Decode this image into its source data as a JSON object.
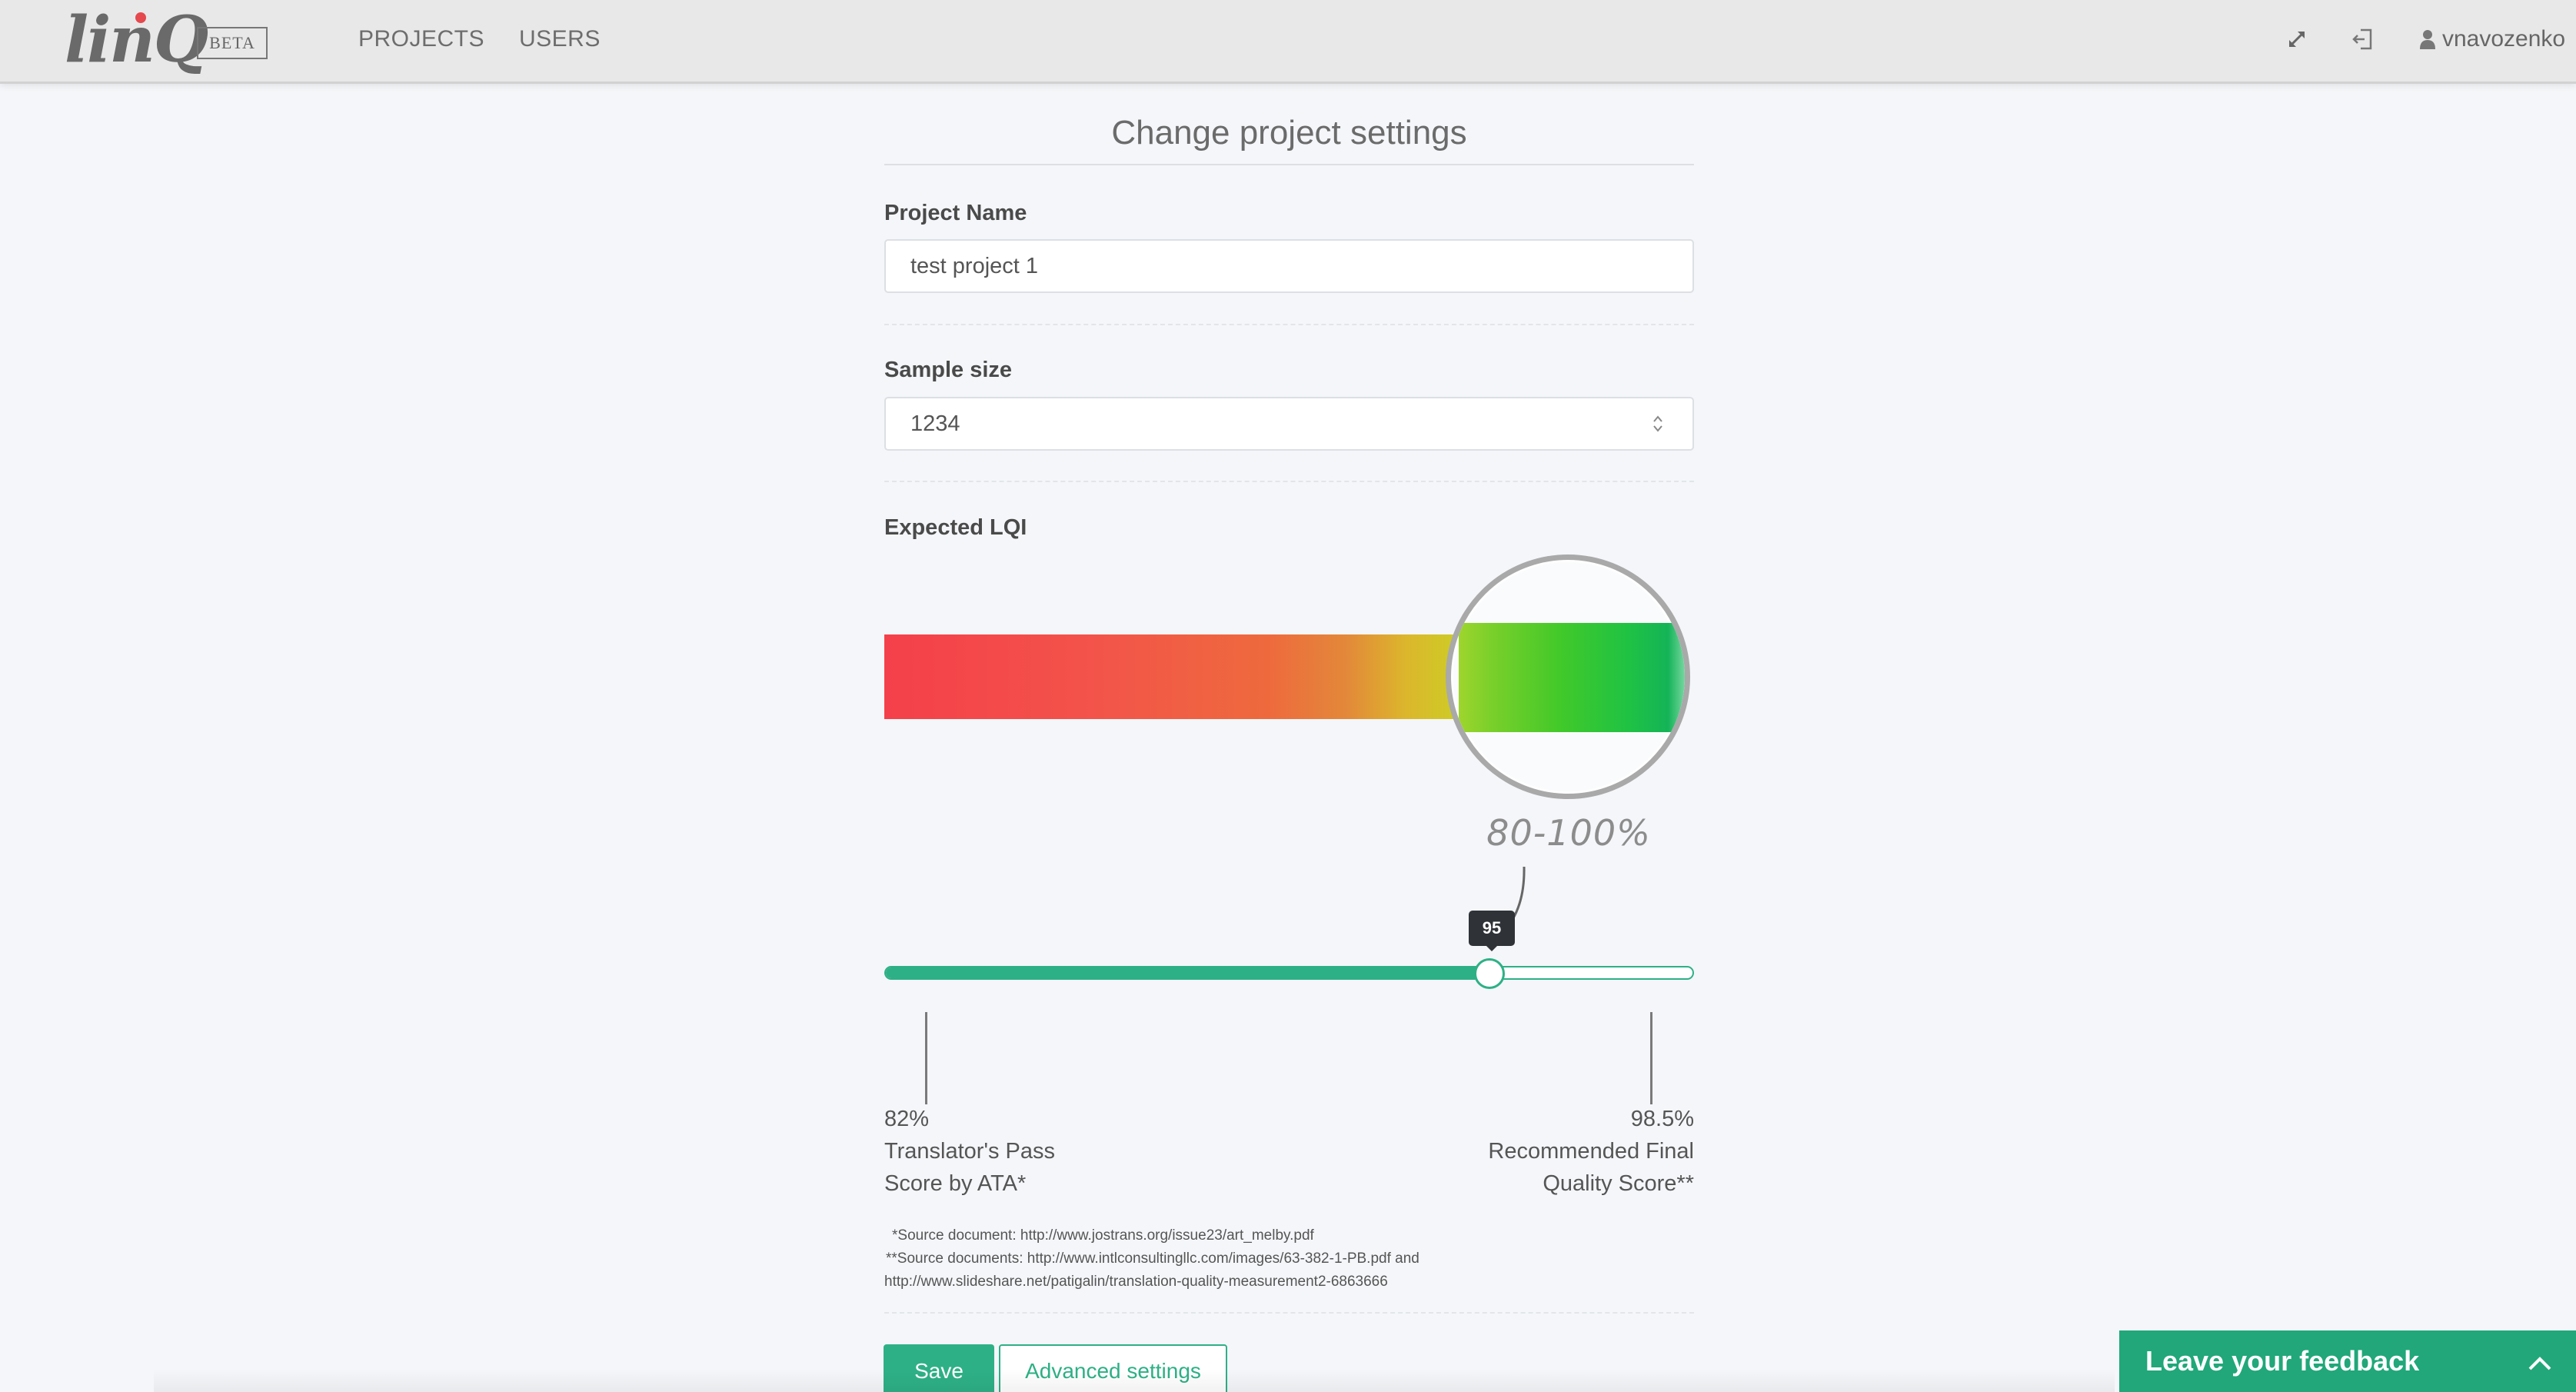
{
  "navbar": {
    "logo_text": "linQ",
    "badge": "BETA",
    "links": [
      {
        "label": "PROJECTS"
      },
      {
        "label": "USERS"
      }
    ],
    "icons": {
      "expand": "expand-icon",
      "signout": "sign-out-icon",
      "user": "user-icon"
    },
    "username": "vnavozenko"
  },
  "page": {
    "title": "Change project settings"
  },
  "form": {
    "project_name": {
      "label": "Project Name",
      "value": "test project 1"
    },
    "sample_size": {
      "label": "Sample size",
      "value": "1234"
    },
    "expected_lqi": {
      "label": "Expected LQI",
      "range_label": "80-100%",
      "slider_value": "95",
      "slider_fraction": 0.745,
      "left_marker": {
        "percent": "82%",
        "line1": "Translator's Pass",
        "line2": "Score by ATA*"
      },
      "right_marker": {
        "percent": "98.5%",
        "line1": "Recommended Final",
        "line2": "Quality Score**"
      }
    },
    "footnotes": {
      "line1": "*Source document: http://www.jostrans.org/issue23/art_melby.pdf",
      "line2": "**Source documents: http://www.intlconsultingllc.com/images/63-382-1-PB.pdf and",
      "line3": "http://www.slideshare.net/patigalin/translation-quality-measurement2-6863666"
    }
  },
  "buttons": {
    "save": "Save",
    "advanced": "Advanced settings"
  },
  "feedback": {
    "label": "Leave your feedback",
    "icon": "chevron-up-icon"
  },
  "colors": {
    "accent": "#2eb086",
    "feedback": "#21a779",
    "navbar": "#e8e8e8"
  }
}
